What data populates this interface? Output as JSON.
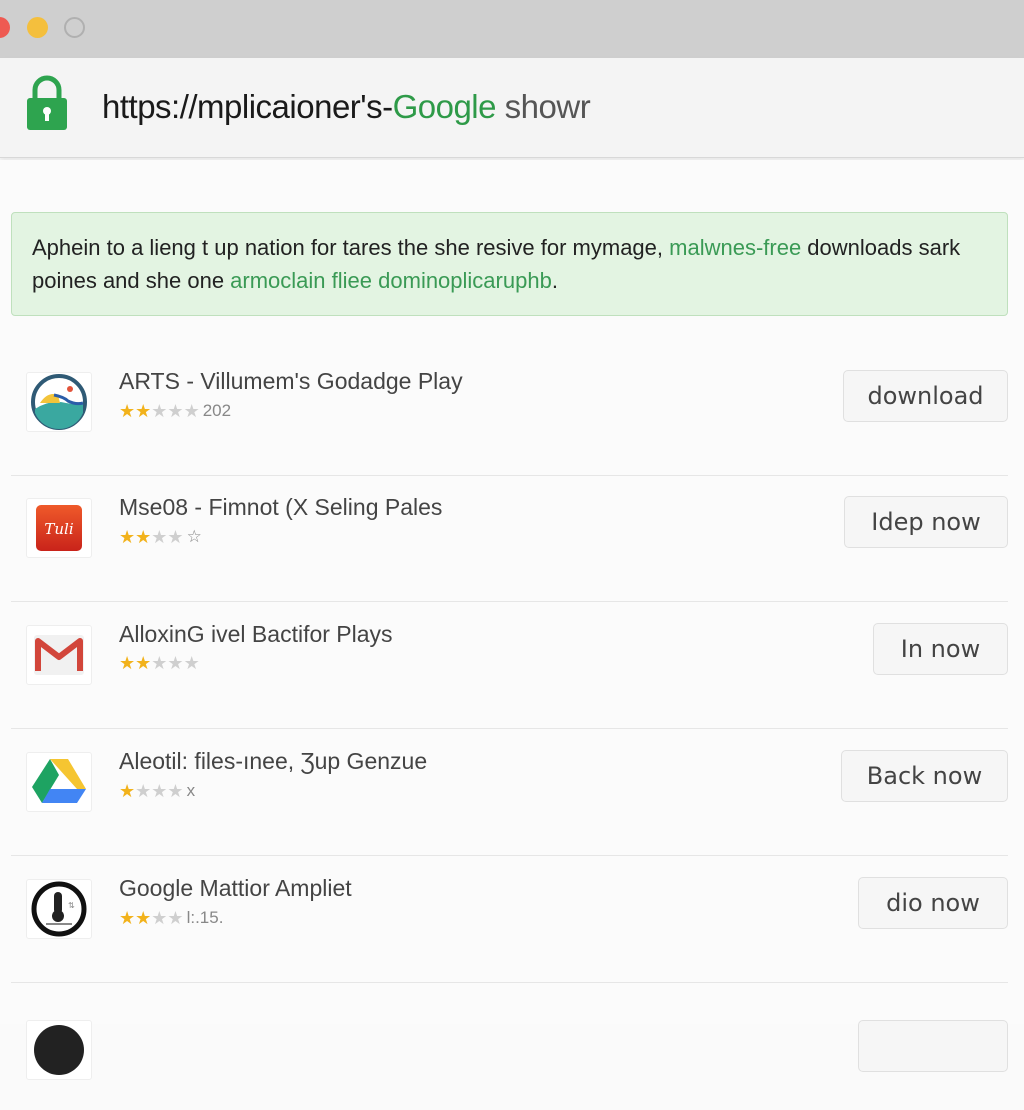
{
  "window": {
    "controls": [
      "close",
      "minimize",
      "zoom"
    ]
  },
  "address_bar": {
    "icon": "lock-icon",
    "url_prefix": "https://mplicaioner's-",
    "url_brand": "Google",
    "url_suffix": " showr",
    "colors": {
      "brand": "#2e9a48",
      "lock": "#2ea44f"
    }
  },
  "banner": {
    "text_1": "Aphein to a lieng t up nation for tares the she resive for mymage, ",
    "link_1": "malwnes-free",
    "text_2": "  downloads sark poines and  she one ",
    "link_2": "armoclain fliee",
    "text_3": "  ",
    "link_3": "dominoplicaruphb",
    "text_4": "."
  },
  "apps": [
    {
      "icon": "landscape-app-icon",
      "title": "ARTS - Villumem's Godadge Play",
      "stars_filled": 2,
      "stars_total": 5,
      "rating_text": "202",
      "button": "download"
    },
    {
      "icon": "red-script-app-icon",
      "title": "Mse08 - Fimnot (X Seling Pales",
      "stars_filled": 2,
      "stars_total": 4,
      "rating_text": "☆",
      "button": "Idep now"
    },
    {
      "icon": "gmail-icon",
      "title": "AlloxinG ivel Bactifor Plays",
      "stars_filled": 2,
      "stars_total": 5,
      "rating_text": "",
      "button": "In now"
    },
    {
      "icon": "google-drive-icon",
      "title": "Aleotil: files-ınee, Ʒup Genzue",
      "stars_filled": 1,
      "stars_total": 4,
      "rating_text": "x",
      "button": "Back now"
    },
    {
      "icon": "thermometer-icon",
      "title": "Google Mattior Ampliet",
      "stars_filled": 2,
      "stars_total": 4,
      "rating_text": "l:.15.",
      "button": "dio now"
    }
  ]
}
